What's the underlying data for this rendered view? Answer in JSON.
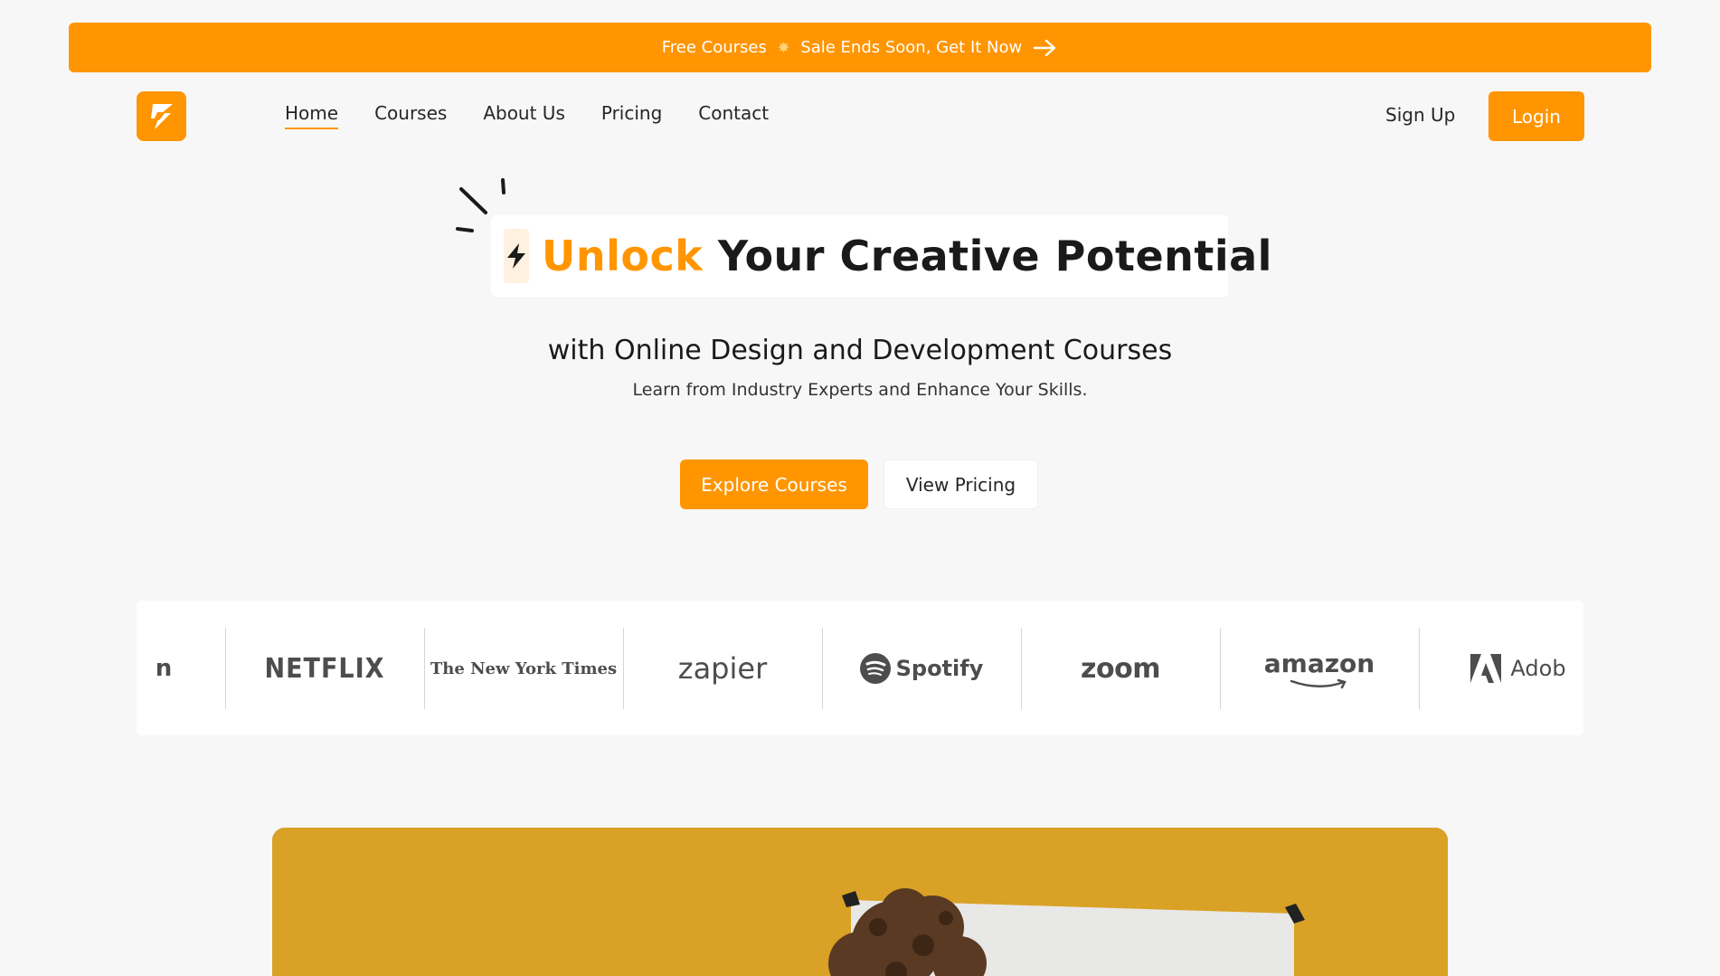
{
  "banner": {
    "text_left": "Free Courses",
    "star": "✸",
    "text_right": "Sale Ends Soon, Get It Now",
    "icon": "arrow-right-icon"
  },
  "colors": {
    "accent": "#ff9500",
    "background": "#f7f7f8",
    "image_bg": "#d9a125"
  },
  "nav": {
    "items": [
      {
        "label": "Home",
        "active": true
      },
      {
        "label": "Courses"
      },
      {
        "label": "About Us"
      },
      {
        "label": "Pricing"
      },
      {
        "label": "Contact"
      }
    ],
    "signup_label": "Sign Up",
    "login_label": "Login"
  },
  "hero": {
    "title_accent": "Unlock",
    "title_rest": " Your Creative Potential",
    "subtitle": "with Online Design and Development Courses",
    "tagline": "Learn from Industry Experts and Enhance Your Skills.",
    "explore_label": "Explore Courses",
    "pricing_label": "View Pricing"
  },
  "brands": {
    "partial": "n",
    "netflix": "NETFLIX",
    "nyt": "The New York Times",
    "zapier": "zapier",
    "spotify": "Spotify",
    "zoom": "zoom",
    "amazon": "amazon",
    "adobe": "Adob"
  }
}
